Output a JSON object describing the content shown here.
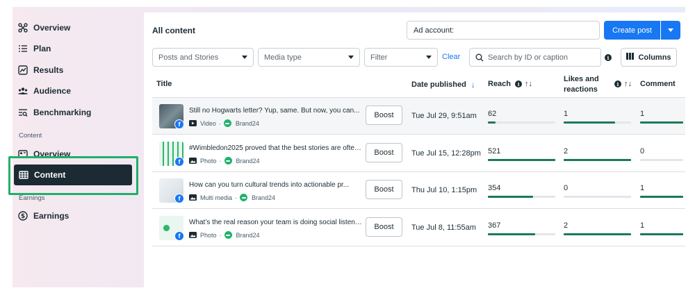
{
  "sidebar": {
    "items": [
      {
        "label": "Overview",
        "icon": "overview-icon"
      },
      {
        "label": "Plan",
        "icon": "plan-icon"
      },
      {
        "label": "Results",
        "icon": "results-icon"
      },
      {
        "label": "Audience",
        "icon": "audience-icon"
      },
      {
        "label": "Benchmarking",
        "icon": "benchmarking-icon"
      }
    ],
    "section_content": "Content",
    "content_overview": "Overview",
    "active_item": "Content",
    "section_earnings": "Earnings",
    "earnings": "Earnings"
  },
  "toolbar": {
    "title": "All content",
    "ad_account": "Ad account:",
    "create_post": "Create post",
    "filter_posts": "Posts and Stories",
    "filter_media": "Media type",
    "filter_generic": "Filter",
    "clear": "Clear",
    "search_placeholder": "Search by ID or caption",
    "columns": "Columns"
  },
  "table": {
    "headers": {
      "title": "Title",
      "date": "Date published",
      "reach": "Reach",
      "likes": "Likes and reactions",
      "comments": "Comment"
    },
    "boost_label": "Boost",
    "rows": [
      {
        "caption": "Still no Hogwarts letter? Yup, same. But now, you can...",
        "type": "Video",
        "page": "Brand24",
        "date": "Tue Jul 29, 9:51am",
        "reach": "62",
        "reach_fill": 0.11,
        "likes": "1",
        "likes_fill": 0.76,
        "comments": "1",
        "comments_fill": 1.0
      },
      {
        "caption": "#Wimbledon2025 proved that the best stories are often...",
        "type": "Photo",
        "page": "Brand24",
        "date": "Tue Jul 15, 12:28pm",
        "reach": "521",
        "reach_fill": 1.0,
        "likes": "2",
        "likes_fill": 1.0,
        "comments": "0",
        "comments_fill": 0.0
      },
      {
        "caption": "How can you turn cultural trends into actionable pr...",
        "type": "Multi media",
        "page": "Brand24",
        "date": "Thu Jul 10, 1:15pm",
        "reach": "354",
        "reach_fill": 0.67,
        "likes": "0",
        "likes_fill": 0.0,
        "comments": "1",
        "comments_fill": 1.0
      },
      {
        "caption": "What’s the real reason your team is doing social listening?",
        "type": "Photo",
        "page": "Brand24",
        "date": "Tue Jul 8, 11:55am",
        "reach": "367",
        "reach_fill": 0.7,
        "likes": "2",
        "likes_fill": 1.0,
        "comments": "1",
        "comments_fill": 1.0
      }
    ]
  },
  "colors": {
    "accent": "#1877f2",
    "nav_active_bg": "#1c2b33",
    "highlight": "#1fb06a",
    "bar": "#1b7a55"
  }
}
